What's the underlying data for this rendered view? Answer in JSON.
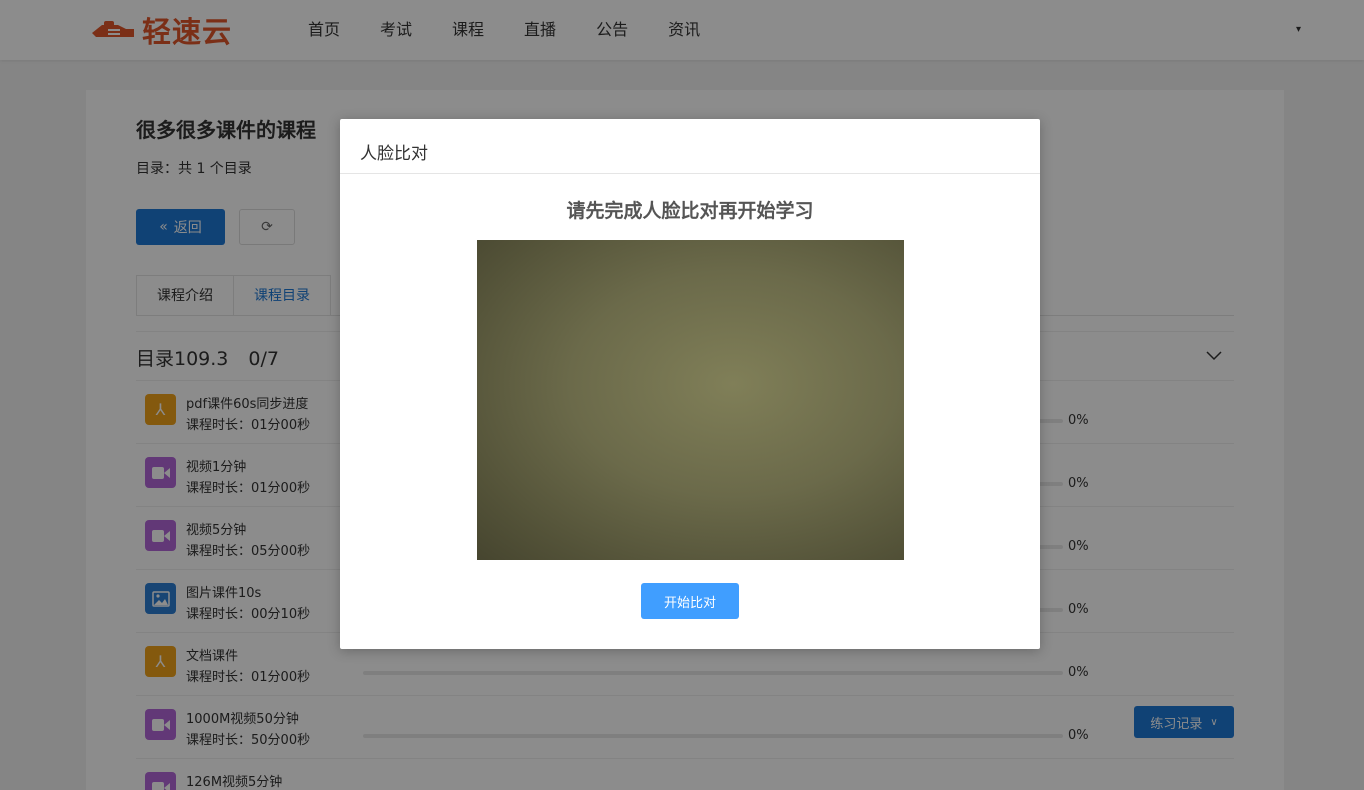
{
  "header": {
    "logo_text": "轻速云",
    "nav": [
      "首页",
      "考试",
      "课程",
      "直播",
      "公告",
      "资讯"
    ],
    "user_caret": "▾"
  },
  "course": {
    "title": "很多很多课件的课程",
    "catalog_count": "目录：共 1 个目录",
    "back_label": "返回",
    "tabs": [
      "课程介绍",
      "课程目录"
    ],
    "active_tab": "课程目录",
    "section": {
      "name": "目录109.3",
      "progress": "0/7"
    },
    "items": [
      {
        "type": "pdf",
        "icon": "pdf-icon",
        "name": "pdf课件60s同步进度",
        "duration": "课程时长：01分00秒",
        "percent": "0%"
      },
      {
        "type": "video",
        "icon": "video-icon",
        "name": "视频1分钟",
        "duration": "课程时长：01分00秒",
        "percent": "0%"
      },
      {
        "type": "video",
        "icon": "video-icon",
        "name": "视频5分钟",
        "duration": "课程时长：05分00秒",
        "percent": "0%"
      },
      {
        "type": "image",
        "icon": "image-icon",
        "name": "图片课件10s",
        "duration": "课程时长：00分10秒",
        "percent": "0%"
      },
      {
        "type": "pdf",
        "icon": "pdf-icon",
        "name": "文档课件",
        "duration": "课程时长：01分00秒",
        "percent": "0%"
      },
      {
        "type": "video",
        "icon": "video-icon",
        "name": "1000M视频50分钟",
        "duration": "课程时长：50分00秒",
        "percent": "0%"
      },
      {
        "type": "video",
        "icon": "video-icon",
        "name": "126M视频5分钟",
        "duration": "",
        "percent": ""
      }
    ],
    "practice_record_label": "练习记录"
  },
  "modal": {
    "title": "人脸比对",
    "prompt": "请先完成人脸比对再开始学习",
    "start_label": "开始比对"
  },
  "colors": {
    "brand": "#e0562a",
    "primary": "#1e78d6",
    "modal_button": "#409eff",
    "pdf": "#f0a21b",
    "video": "#b266d9",
    "image": "#2c7fd4"
  }
}
